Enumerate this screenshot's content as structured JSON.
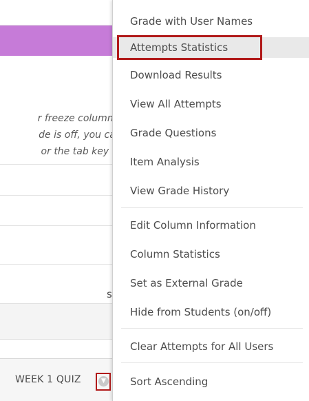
{
  "grid": {
    "hint_lines": [
      "r freeze columns o",
      "de is off, you can i",
      "or the tab key to i"
    ],
    "partial_text": "s",
    "column_header": {
      "label": "WEEK 1 QUIZ",
      "chevron_icon": "chevron-down-icon"
    }
  },
  "context_menu": {
    "highlight_color": "#b11a1a",
    "items": [
      {
        "label": "Grade with User Names"
      },
      {
        "label": "Attempts Statistics",
        "highlighted": true
      },
      {
        "label": "Download Results"
      },
      {
        "label": "View All Attempts"
      },
      {
        "label": "Grade Questions"
      },
      {
        "label": "Item Analysis"
      },
      {
        "label": "View Grade History"
      },
      {
        "label": "Edit Column Information"
      },
      {
        "label": "Column Statistics"
      },
      {
        "label": "Set as External Grade"
      },
      {
        "label": "Hide from Students (on/off)"
      },
      {
        "label": "Clear Attempts for All Users"
      },
      {
        "label": "Sort Ascending"
      }
    ]
  },
  "colors": {
    "purple_bar": "#c67bd8",
    "callout_red": "#b11a1a"
  }
}
